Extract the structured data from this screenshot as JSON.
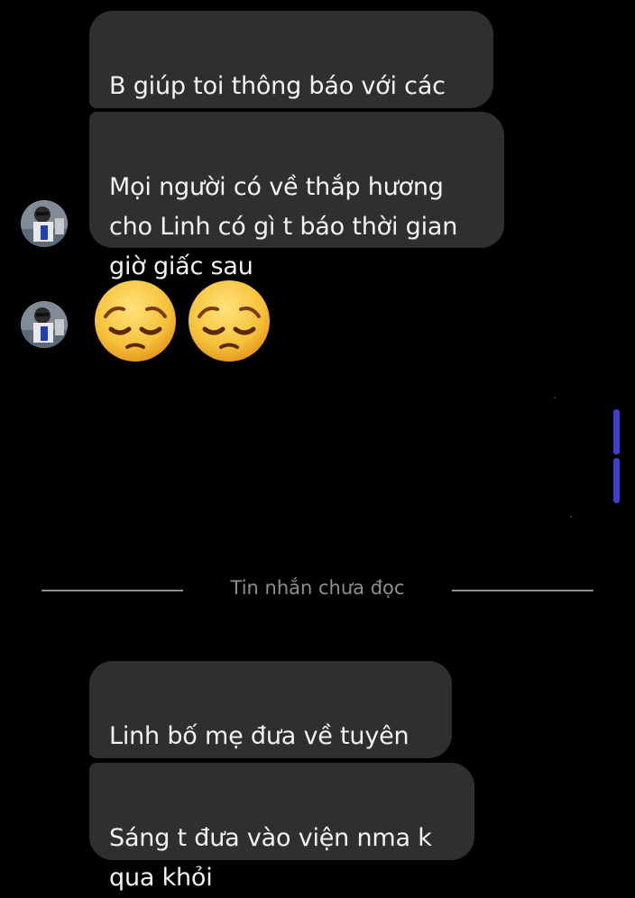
{
  "messages": [
    {
      "text": "B giúp toi thông báo với các\nbạn Linh nhé"
    },
    {
      "text": "Mọi người có về thắp hương\ncho Linh có gì t báo thời gian\ngiờ giấc sau"
    },
    {
      "emoji": [
        "pensive-face",
        "pensive-face"
      ]
    },
    {
      "text": "Linh bố mẹ đưa về tuyên\nquang rồi"
    },
    {
      "text": "Sáng t đưa vào viện nma k\nqua khỏi"
    }
  ],
  "divider": {
    "label": "Tin nhắn chưa đọc"
  },
  "colors": {
    "background": "#000000",
    "bubble": "#2f2f31",
    "bubble_text": "#f2f2f2",
    "divider": "#8c8c8c",
    "divider_text": "#8e8e93",
    "emoji_face": "#f7c23b"
  }
}
